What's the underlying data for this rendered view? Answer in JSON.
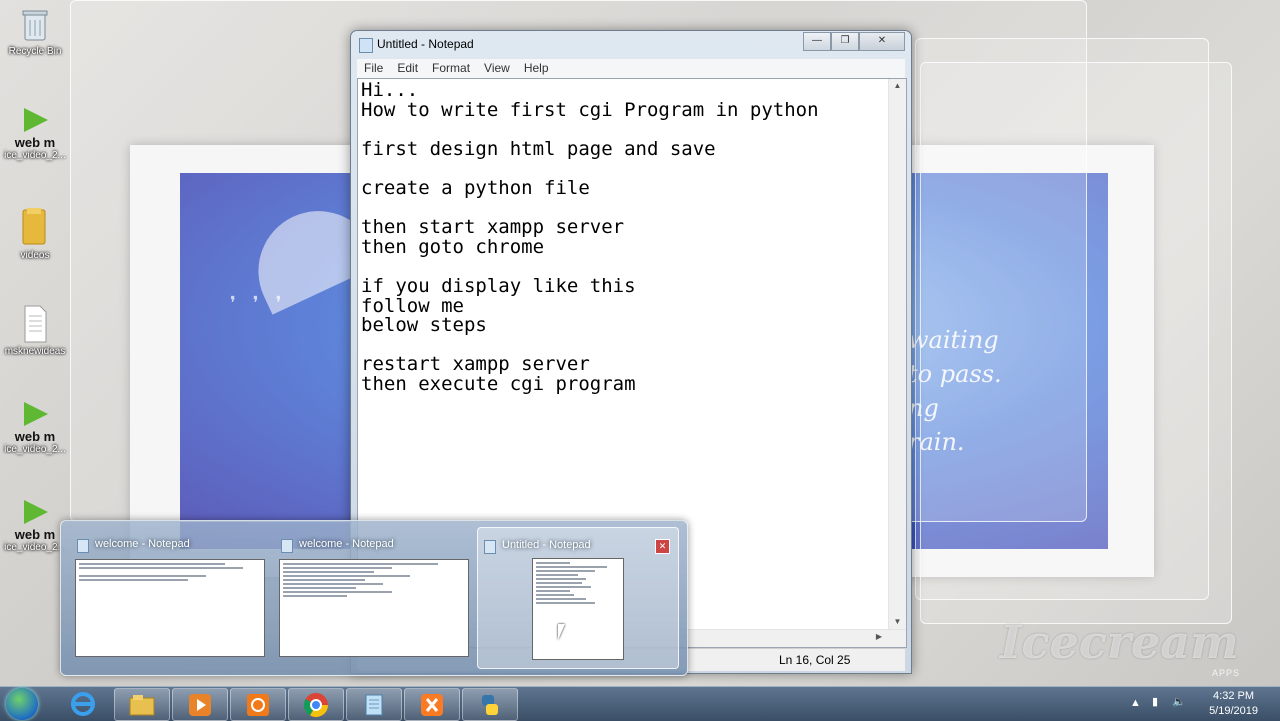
{
  "desktop": {
    "icons": [
      {
        "label": "Recycle Bin",
        "type": "recycle"
      },
      {
        "label": "web m",
        "sub": "ice_video_2...",
        "type": "webm"
      },
      {
        "label": "videos",
        "type": "folder"
      },
      {
        "label": "msknewideas",
        "type": "file"
      },
      {
        "label": "web m",
        "sub": "ice_video_2...",
        "type": "webm"
      },
      {
        "label": "web m",
        "sub": "ice_video_2...",
        "type": "webm"
      }
    ],
    "photo_text": [
      "waiting",
      "to pass.",
      "ng",
      "rain."
    ]
  },
  "notepad": {
    "title": "Untitled - Notepad",
    "menu": [
      "File",
      "Edit",
      "Format",
      "View",
      "Help"
    ],
    "content": "Hi...\nHow to write first cgi Program in python\n\nfirst design html page and save\n\ncreate a python file\n\nthen start xampp server\nthen goto chrome\n\nif you display like this\nfollow me\nbelow steps\n\nrestart xampp server\nthen execute cgi program",
    "status": "Ln 16, Col 25"
  },
  "thumbnails": [
    {
      "title": "welcome - Notepad",
      "active": false
    },
    {
      "title": "welcome - Notepad",
      "active": false
    },
    {
      "title": "Untitled - Notepad",
      "active": true
    }
  ],
  "taskbar": {
    "items": [
      "internet-explorer",
      "file-explorer",
      "media-player",
      "app-orange",
      "chrome",
      "notepad",
      "xampp",
      "python"
    ],
    "time": "4:32 PM",
    "date": "5/19/2019"
  },
  "watermark": {
    "text": "Icecream",
    "sub": "APPS"
  }
}
